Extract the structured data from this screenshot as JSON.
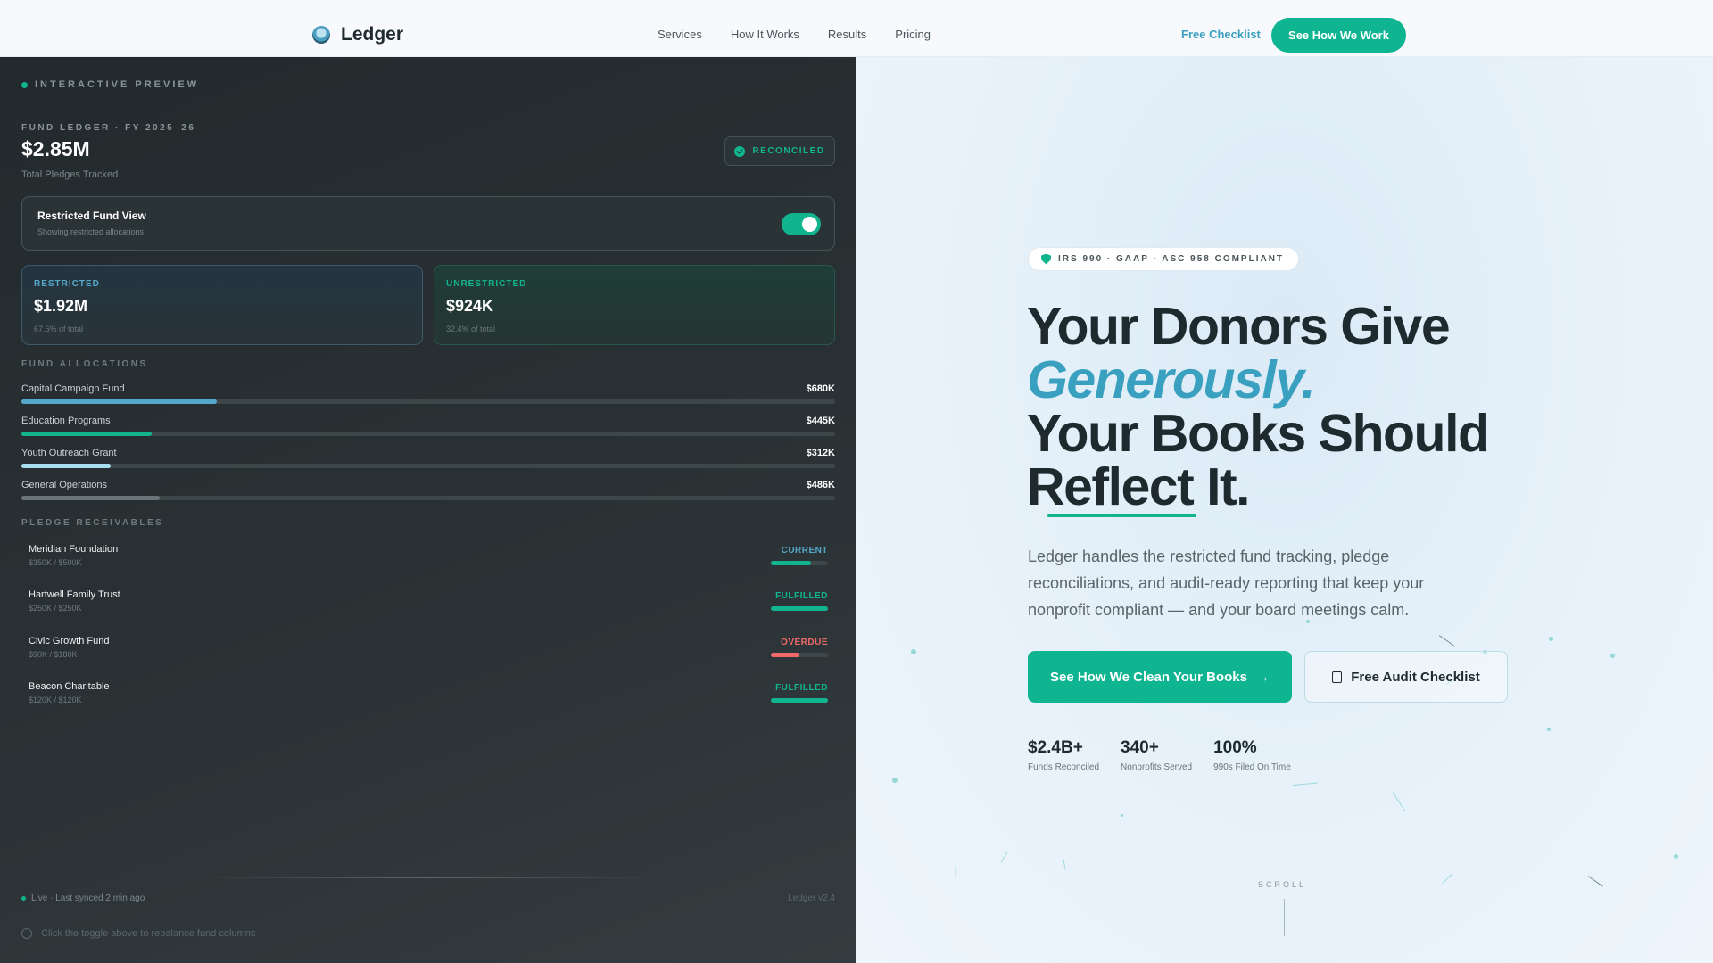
{
  "nav": {
    "brand": "Ledger",
    "links": [
      "Services",
      "How It Works",
      "Results",
      "Pricing"
    ],
    "cta_link": "Free Checklist",
    "cta_button": "See How We Work"
  },
  "preview": {
    "tag": "INTERACTIVE PREVIEW",
    "fund_label": "FUND LEDGER · FY 2025–26",
    "total": "$2.85M",
    "total_sub": "Total Pledges Tracked",
    "status": "RECONCILED",
    "toggle": {
      "title": "Restricted Fund View",
      "subtitle": "Showing restricted allocations",
      "on": true
    },
    "restricted": {
      "label": "RESTRICTED",
      "value": "$1.92M",
      "pct": "67.6% of total"
    },
    "unrestricted": {
      "label": "UNRESTRICTED",
      "value": "$924K",
      "pct": "32.4% of total"
    },
    "allocations_label": "FUND ALLOCATIONS",
    "allocations": [
      {
        "name": "Capital Campaign Fund",
        "value": "$680K",
        "fill": 0.24,
        "color": "#56a8ca"
      },
      {
        "name": "Education Programs",
        "value": "$445K",
        "fill": 0.16,
        "color": "#12b48f"
      },
      {
        "name": "Youth Outreach Grant",
        "value": "$312K",
        "fill": 0.11,
        "color": "#a8dff0"
      },
      {
        "name": "General Operations",
        "value": "$486K",
        "fill": 0.17,
        "color": "#6b7478"
      }
    ],
    "receivables_label": "PLEDGE RECEIVABLES",
    "pledges": [
      {
        "name": "Meridian Foundation",
        "amount": "$350K / $500K",
        "status": "CURRENT",
        "color": "#56a8ca",
        "fill": 0.7,
        "bar": "#12b48f"
      },
      {
        "name": "Hartwell Family Trust",
        "amount": "$250K / $250K",
        "status": "FULFILLED",
        "color": "#12b48f",
        "fill": 1.0,
        "bar": "#12b48f"
      },
      {
        "name": "Civic Growth Fund",
        "amount": "$90K / $180K",
        "status": "OVERDUE",
        "color": "#f06a6a",
        "fill": 0.5,
        "bar": "#f06a6a"
      },
      {
        "name": "Beacon Charitable",
        "amount": "$120K / $120K",
        "status": "FULFILLED",
        "color": "#12b48f",
        "fill": 1.0,
        "bar": "#12b48f"
      }
    ],
    "sync": "Live · Last synced 2 min ago",
    "version": "Ledger v2.4",
    "hint": "Click the toggle above to rebalance fund columns"
  },
  "hero": {
    "badge": "IRS 990 · GAAP · ASC 958 COMPLIANT",
    "headline_1": "Your Donors Give",
    "headline_accent": "Generously.",
    "headline_2": "Your Books Should",
    "headline_3": "Reflect It.",
    "lead": "Ledger handles the restricted fund tracking, pledge reconciliations, and audit-ready reporting that keep your nonprofit compliant — and your board meetings calm.",
    "primary_cta": "See How We Clean Your Books",
    "secondary_cta": "Free Audit Checklist",
    "metrics": [
      {
        "value": "$2.4B+",
        "label": "Funds Reconciled"
      },
      {
        "value": "340+",
        "label": "Nonprofits Served"
      },
      {
        "value": "100%",
        "label": "990s Filed On Time"
      }
    ],
    "scroll": "SCROLL"
  },
  "colors": {
    "accent": "#12b48f",
    "accent_blue": "#3aa0c0",
    "dark_panel": "#222a2d"
  }
}
